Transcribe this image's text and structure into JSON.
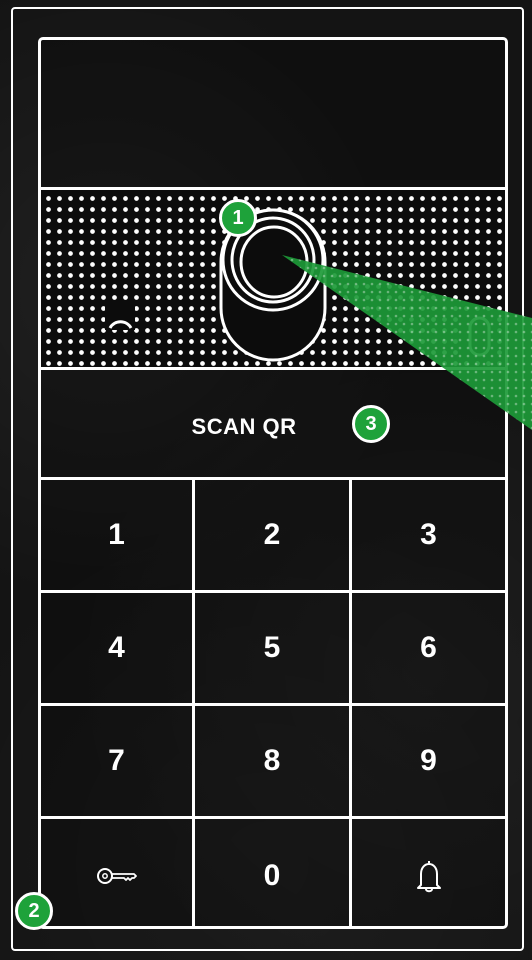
{
  "scan_label": "SCAN QR",
  "badges": {
    "one": "1",
    "two": "2",
    "three": "3"
  },
  "keypad": {
    "keys": [
      "1",
      "2",
      "3",
      "4",
      "5",
      "6",
      "7",
      "8",
      "9",
      "0"
    ],
    "bottom_left_icon": "key-icon",
    "bottom_right_icon": "bell-icon"
  },
  "speaker_icons": {
    "left": "handset-arc-icon",
    "right": "led-indicator-icon",
    "center": "camera-lens-icon"
  },
  "colors": {
    "accent": "#1ea23a",
    "line": "#ffffff",
    "background": "#141414"
  }
}
